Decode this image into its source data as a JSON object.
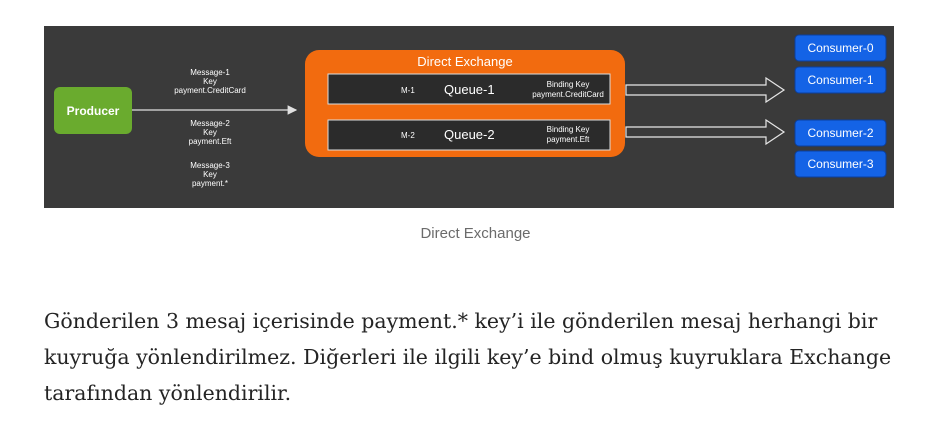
{
  "diagram": {
    "producer": "Producer",
    "exchange_title": "Direct Exchange",
    "messages": [
      {
        "name": "Message-1",
        "key_label": "Key",
        "key": "payment.CreditCard"
      },
      {
        "name": "Message-2",
        "key_label": "Key",
        "key": "payment.Eft"
      },
      {
        "name": "Message-3",
        "key_label": "Key",
        "key": "payment.*"
      }
    ],
    "queues": [
      {
        "msg": "M-1",
        "name": "Queue-1",
        "binding_label": "Binding Key",
        "binding_key": "payment.CreditCard"
      },
      {
        "msg": "M-2",
        "name": "Queue-2",
        "binding_label": "Binding Key",
        "binding_key": "payment.Eft"
      }
    ],
    "consumers": [
      "Consumer-0",
      "Consumer-1",
      "Consumer-2",
      "Consumer-3"
    ],
    "colors": {
      "background": "#3a3a3a",
      "producer": "#6aab2e",
      "exchange": "#f26b0f",
      "queue": "#2b2b2b",
      "consumer": "#1463e6"
    }
  },
  "caption": "Direct Exchange",
  "paragraph": "Gönderilen 3 mesaj içerisinde payment.* key’i ile gönderilen mesaj herhangi bir kuyruğa yönlendirilmez. Diğerleri ile ilgili key’e bind olmuş kuyruklara Exchange tarafından yönlendirilir."
}
